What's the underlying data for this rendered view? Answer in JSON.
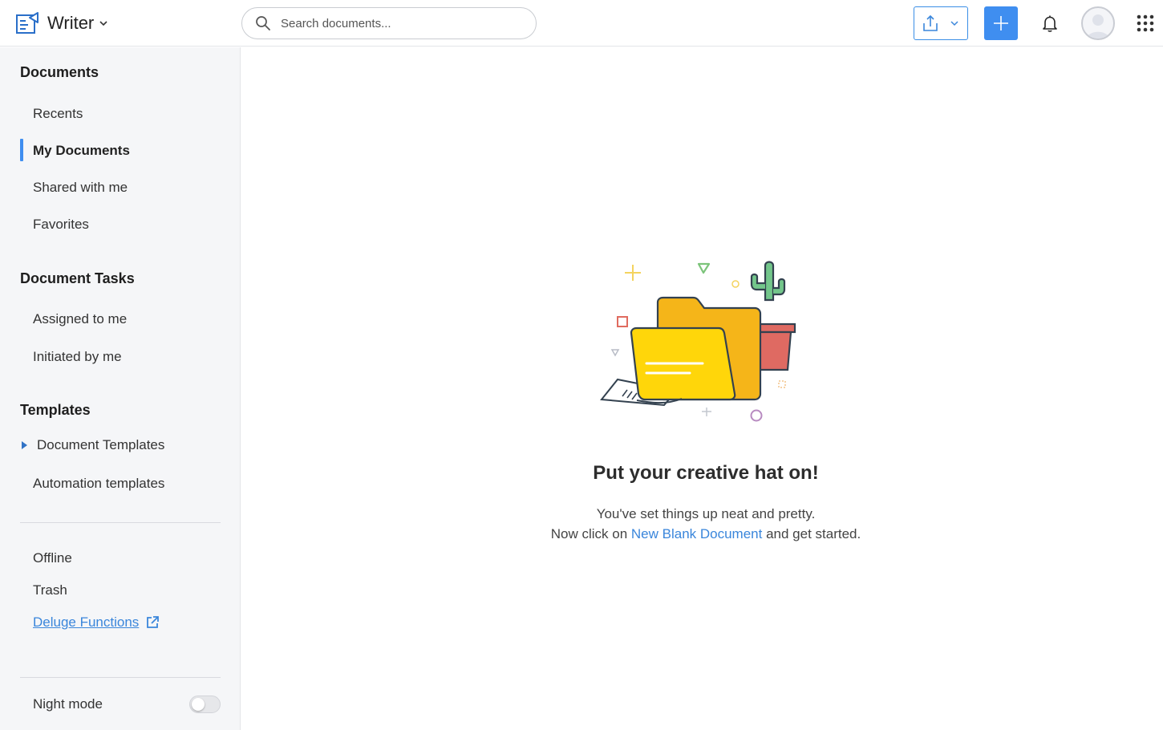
{
  "app": {
    "name": "Writer",
    "logo_icon": "writer-logo-icon",
    "accent_color": "#3f8ef0",
    "link_color": "#3a86db"
  },
  "header": {
    "search_placeholder": "Search documents...",
    "upload_icon": "upload-icon",
    "new_icon": "plus-icon",
    "notifications_icon": "bell-icon",
    "apps_icon": "grid-icon"
  },
  "sidebar": {
    "documents": {
      "title": "Documents",
      "items": [
        {
          "label": "Recents",
          "active": false
        },
        {
          "label": "My Documents",
          "active": true
        },
        {
          "label": "Shared with me",
          "active": false
        },
        {
          "label": "Favorites",
          "active": false
        }
      ]
    },
    "tasks": {
      "title": "Document Tasks",
      "items": [
        {
          "label": "Assigned to me"
        },
        {
          "label": "Initiated by me"
        }
      ]
    },
    "templates": {
      "title": "Templates",
      "items": [
        {
          "label": "Document Templates",
          "expandable": true
        },
        {
          "label": "Automation templates"
        }
      ]
    },
    "extra": {
      "offline": "Offline",
      "trash": "Trash",
      "deluge": "Deluge Functions"
    },
    "night_mode": {
      "label": "Night mode",
      "enabled": false
    }
  },
  "main": {
    "empty_state": {
      "title": "Put your creative hat on!",
      "line1": "You've set things up neat and pretty.",
      "line2_prefix": "Now click on ",
      "line2_link": "New Blank Document",
      "line2_suffix": " and get started."
    }
  }
}
